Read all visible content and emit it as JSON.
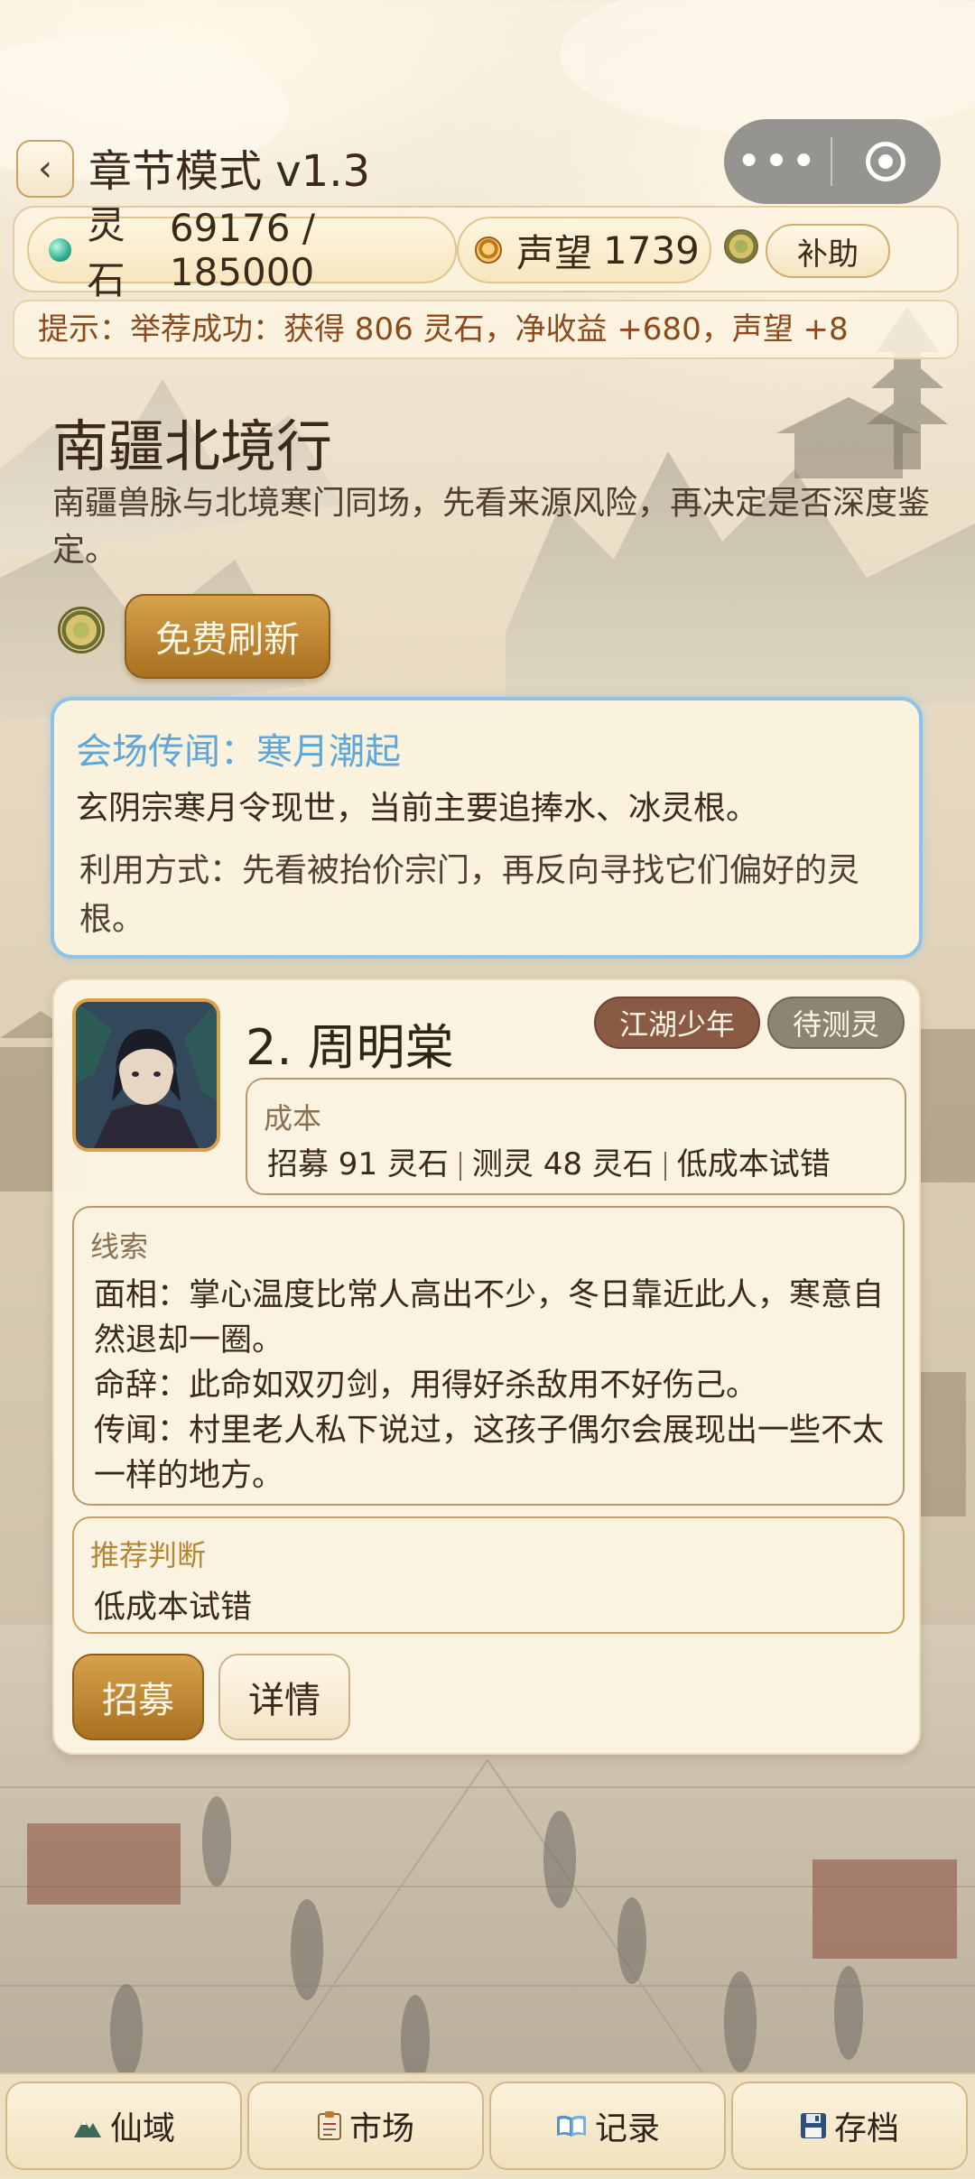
{
  "header": {
    "back_icon": "‹",
    "title": "章节模式 v1.3",
    "menu_icon": "•••"
  },
  "resources": {
    "spirit_stone_label": "灵石",
    "spirit_stone_value": "69176 / 185000",
    "reputation_label": "声望",
    "reputation_value": "1739",
    "subsidy_label": "补助"
  },
  "tip": "提示：举荐成功：获得 806 灵石，净收益 +680，声望 +8",
  "section": {
    "title": "南疆北境行",
    "description": "南疆兽脉与北境寒门同场，先看来源风险，再决定是否深度鉴定。",
    "refresh_label": "免费刷新"
  },
  "rumor": {
    "title": "会场传闻：寒月潮起",
    "body": "玄阴宗寒月令现世，当前主要追捧水、冰灵根。",
    "usage": "利用方式：先看被抬价宗门，再反向寻找它们偏好的灵根。"
  },
  "candidate": {
    "name": "2. 周明棠",
    "tags": [
      "江湖少年",
      "待测灵"
    ],
    "cost_label": "成本",
    "cost_recruit": "招募 91 灵石",
    "cost_test": "测灵 48 灵石",
    "cost_note": "低成本试错",
    "clue_label": "线索",
    "clues": [
      "面相：掌心温度比常人高出不少，冬日靠近此人，寒意自然退却一圈。",
      "命辞：此命如双刃剑，用得好杀敌用不好伤己。",
      "传闻：村里老人私下说过，这孩子偶尔会展现出一些不太一样的地方。"
    ],
    "judge_label": "推荐判断",
    "judge_value": "低成本试错",
    "recruit_label": "招募",
    "detail_label": "详情"
  },
  "bottom_nav": [
    {
      "icon": "mountain-icon",
      "label": "仙域"
    },
    {
      "icon": "clipboard-icon",
      "label": "市场"
    },
    {
      "icon": "book-icon",
      "label": "记录"
    },
    {
      "icon": "floppy-disk-icon",
      "label": "存档"
    }
  ],
  "colors": {
    "accent_gold": "#b8812c",
    "rumor_blue": "#5ea7d8",
    "tag_brown": "#8a5a44",
    "tag_gray": "#8d8475",
    "tip_text": "#8a4a1c"
  }
}
